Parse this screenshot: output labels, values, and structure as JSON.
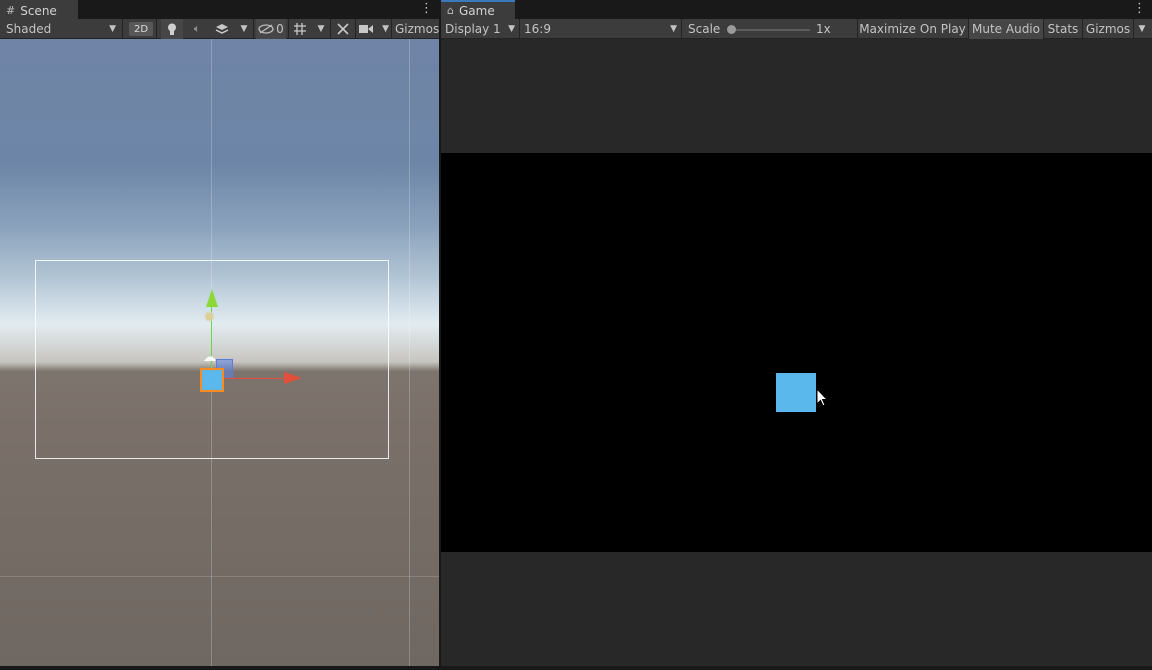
{
  "scene": {
    "tab_label": "Scene",
    "tab_icon": "hash-icon",
    "draw_mode": "Shaded",
    "btn_2d": "2D",
    "hidden_count": "0",
    "gizmos_label": "Gizmos"
  },
  "game": {
    "tab_label": "Game",
    "tab_icon": "gamepad-icon",
    "display": "Display 1",
    "aspect": "16:9",
    "scale_label": "Scale",
    "scale_value": "1x",
    "scale_level": 0.0,
    "maximize_label": "Maximize On Play",
    "mute_label": "Mute Audio",
    "stats_label": "Stats",
    "gizmos_label": "Gizmos"
  },
  "colors": {
    "panel_bg": "#282828",
    "toolbar_bg": "#3c3c3c",
    "active_tab_accent": "#3a79bb",
    "cube": "#5ab8ec",
    "selection_outline": "#ff8a1e",
    "axis_x": "#e0503a",
    "axis_y": "#8bd837"
  }
}
